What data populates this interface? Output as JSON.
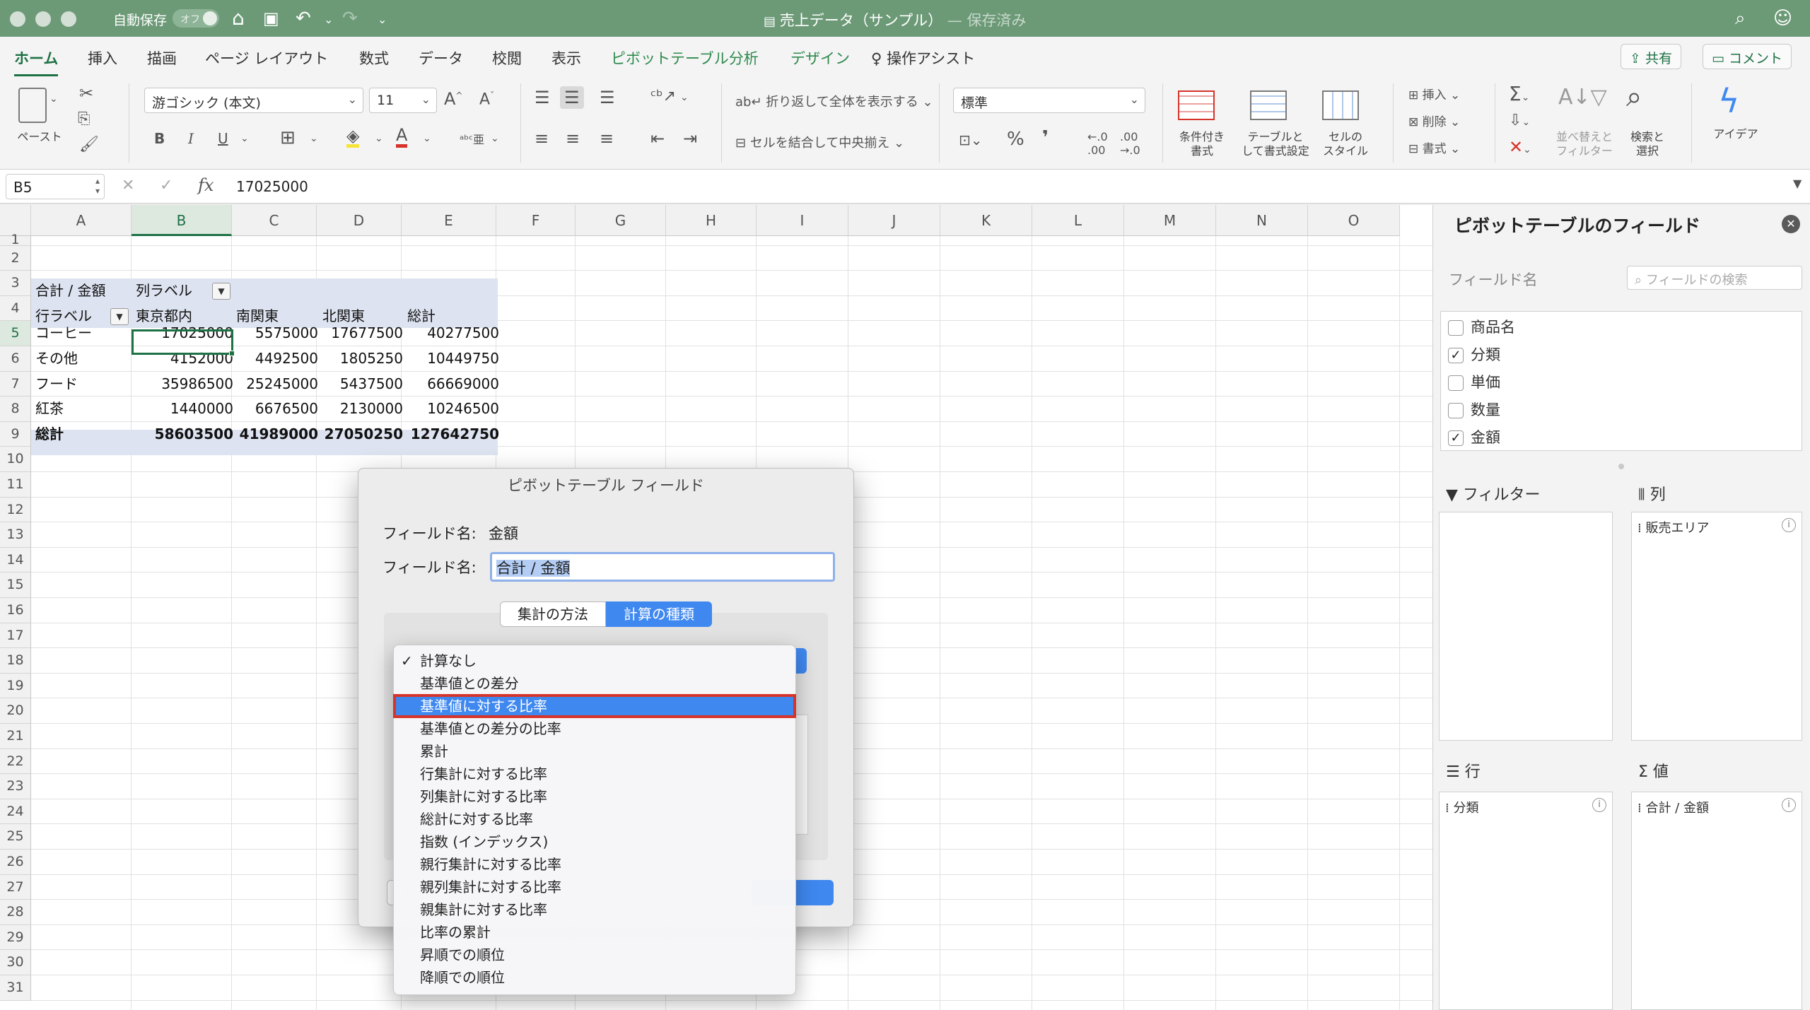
{
  "titlebar": {
    "autosave_label": "自動保存",
    "autosave_state": "オフ",
    "doc_title": "売上データ（サンプル）",
    "doc_status": "— 保存済み"
  },
  "tabs": [
    "ホーム",
    "挿入",
    "描画",
    "ページ レイアウト",
    "数式",
    "データ",
    "校閲",
    "表示",
    "ピボットテーブル分析",
    "デザイン",
    "操作アシスト"
  ],
  "share_label": "共有",
  "comment_label": "コメント",
  "ribbon": {
    "paste": "ペースト",
    "font_name": "游ゴシック (本文)",
    "font_size": "11",
    "bold": "B",
    "italic": "I",
    "underline": "U",
    "wrap_text": "折り返して全体を表示する",
    "merge_center": "セルを結合して中央揃え",
    "number_format": "標準",
    "cond_format": "条件付き\n書式",
    "format_table": "テーブルと\nして書式設定",
    "cell_style": "セルの\nスタイル",
    "insert": "挿入",
    "delete": "削除",
    "format": "書式",
    "sort_filter": "並べ替えと\nフィルター",
    "find_select": "検索と\n選択",
    "ideas": "アイデア"
  },
  "formula": {
    "name_box": "B5",
    "value": "17025000"
  },
  "grid": {
    "columns": [
      "A",
      "B",
      "C",
      "D",
      "E",
      "F",
      "G",
      "H",
      "I",
      "J",
      "K",
      "L",
      "M",
      "N",
      "O"
    ],
    "rows": [
      "1",
      "2",
      "3",
      "4",
      "5",
      "6",
      "7",
      "8",
      "9",
      "10",
      "11",
      "12",
      "13",
      "14",
      "15",
      "16",
      "17",
      "18",
      "19",
      "20",
      "21",
      "22",
      "23",
      "24",
      "25",
      "26",
      "27",
      "28",
      "29",
      "30",
      "31"
    ],
    "pivot": {
      "r3_a": "合計 / 金額",
      "r3_b": "列ラベル",
      "r4_a": "行ラベル",
      "headers": [
        "東京都内",
        "南関東",
        "北関東",
        "総計"
      ],
      "rows": [
        {
          "label": "コーヒー",
          "values": [
            "17025000",
            "5575000",
            "17677500",
            "40277500"
          ]
        },
        {
          "label": "その他",
          "values": [
            "4152000",
            "4492500",
            "1805250",
            "10449750"
          ]
        },
        {
          "label": "フード",
          "values": [
            "35986500",
            "25245000",
            "5437500",
            "66669000"
          ]
        },
        {
          "label": "紅茶",
          "values": [
            "1440000",
            "6676500",
            "2130000",
            "10246500"
          ]
        }
      ],
      "total": {
        "label": "総計",
        "values": [
          "58603500",
          "41989000",
          "27050250",
          "127642750"
        ]
      }
    }
  },
  "pane": {
    "title": "ピボットテーブルのフィールド",
    "field_name_header": "フィールド名",
    "search_placeholder": "フィールドの検索",
    "fields": [
      {
        "name": "商品名",
        "checked": false
      },
      {
        "name": "分類",
        "checked": true
      },
      {
        "name": "単価",
        "checked": false
      },
      {
        "name": "数量",
        "checked": false
      },
      {
        "name": "金額",
        "checked": true
      }
    ],
    "filter_label": "フィルター",
    "columns_label": "列",
    "rows_label": "行",
    "values_label": "値",
    "columns_item": "販売エリア",
    "rows_item": "分類",
    "values_item": "合計 / 金額"
  },
  "dialog": {
    "title": "ピボットテーブル フィールド",
    "source_label": "フィールド名:",
    "source_value": "金額",
    "name_label": "フィールド名:",
    "name_value": "合計 / 金額",
    "tab_summarize": "集計の方法",
    "tab_calc": "計算の種類"
  },
  "menu": {
    "checked_item": 0,
    "selected_item": 2,
    "items": [
      "計算なし",
      "基準値との差分",
      "基準値に対する比率",
      "基準値との差分の比率",
      "累計",
      "行集計に対する比率",
      "列集計に対する比率",
      "総計に対する比率",
      "指数 (インデックス)",
      "親行集計に対する比率",
      "親列集計に対する比率",
      "親集計に対する比率",
      "比率の累計",
      "昇順での順位",
      "降順での順位"
    ]
  },
  "colors": {
    "titlebar": "#6c9a77",
    "accent_green": "#1e7145",
    "pivot_band": "#dde3f0",
    "menu_select": "#3f88f0",
    "highlight_border": "#d6342a"
  }
}
